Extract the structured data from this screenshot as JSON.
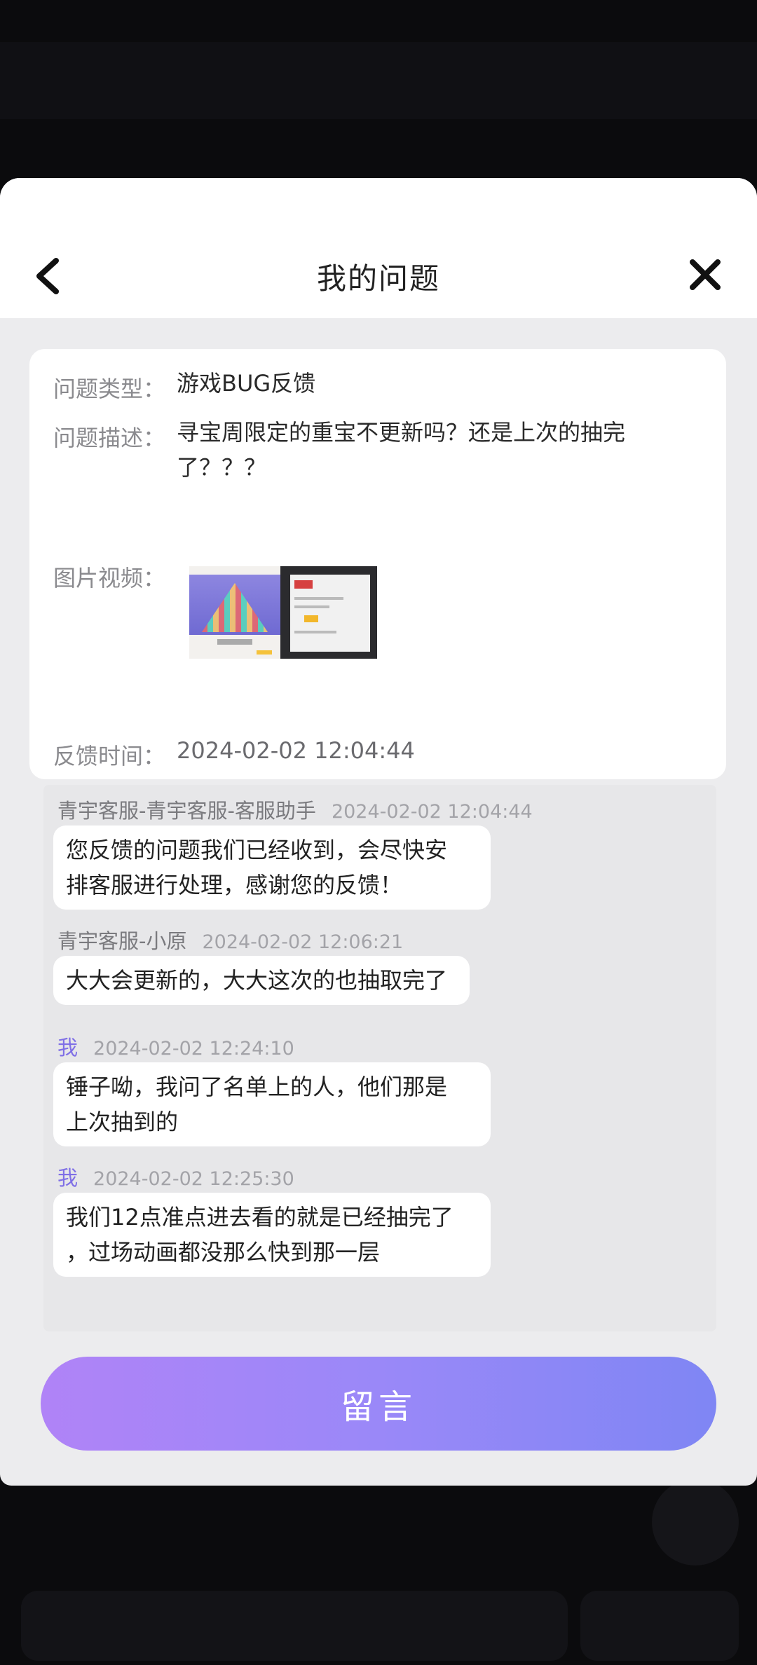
{
  "header": {
    "title": "我的问题"
  },
  "info": {
    "type_label": "问题类型：",
    "type_value": "游戏BUG反馈",
    "desc_label": "问题描述：",
    "desc_value": "寻宝周限定的重宝不更新吗？还是上次的抽完了？？？",
    "media_label": "图片视频：",
    "time_label": "反馈时间：",
    "time_value": "2024-02-02 12:04:44"
  },
  "messages": [
    {
      "sender": "青宇客服-青宇客服-客服助手",
      "time": "2024-02-02 12:04:44",
      "text_lines": [
        "您反馈的问题我们已经收到，会尽快安",
        "排客服进行处理，感谢您的反馈！"
      ]
    },
    {
      "sender": "青宇客服-小原",
      "time": "2024-02-02 12:06:21",
      "text_lines": [
        "大大会更新的，大大这次的也抽取完了"
      ]
    },
    {
      "sender": "我",
      "time": "2024-02-02 12:24:10",
      "text_lines": [
        "锤子呦，我问了名单上的人，他们那是",
        "上次抽到的"
      ]
    },
    {
      "sender": "我",
      "time": "2024-02-02 12:25:30",
      "text_lines": [
        "我们12点准点进去看的就是已经抽完了",
        "，过场动画都没那么快到那一层"
      ]
    }
  ],
  "footer": {
    "button_label": "留言"
  },
  "colors": {
    "accent_start": "#b083f7",
    "accent_end": "#7f86f4",
    "me_color": "#7f6fe6"
  }
}
